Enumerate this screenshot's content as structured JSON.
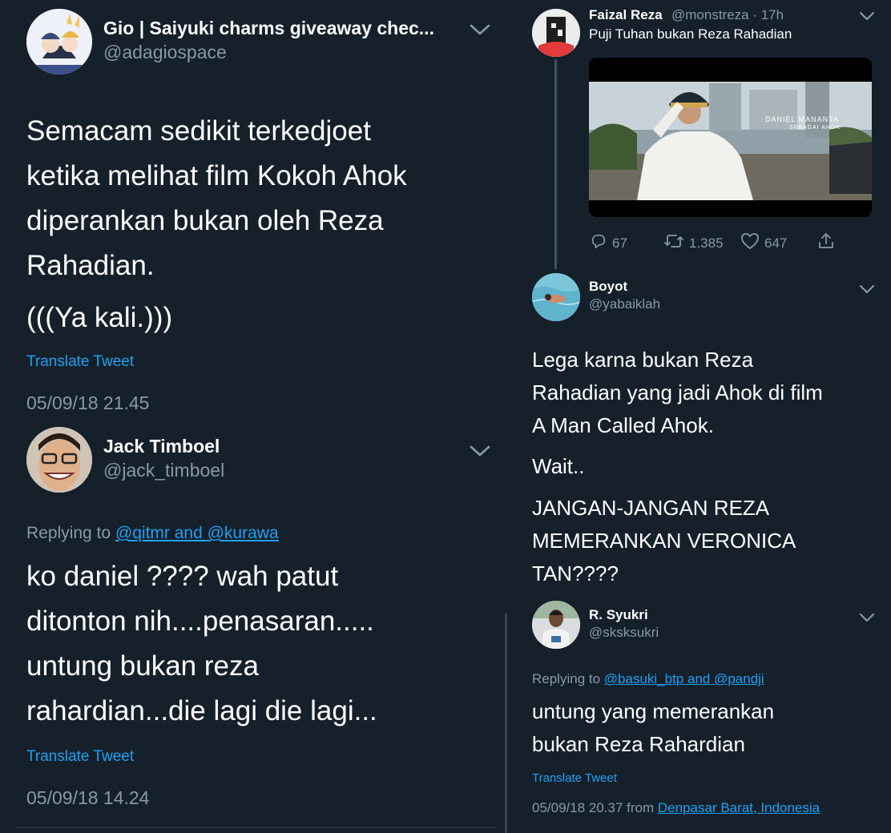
{
  "left": {
    "tweet1": {
      "name": "Gio | Saiyuki charms giveaway chec...",
      "handle": "@adagiospace",
      "text_lines": [
        "Semacam sedikit terkedjoet",
        "ketika melihat film Kokoh Ahok",
        "diperankan bukan oleh Reza",
        "Rahadian."
      ],
      "text2": "(((Ya kali.)))",
      "translate": "Translate Tweet",
      "timestamp": "05/09/18 21.45"
    },
    "tweet2": {
      "name": "Jack Timboel",
      "handle": "@jack_timboel",
      "replying_prefix": "Replying to ",
      "replying_link": "@qitmr and @kurawa",
      "text_lines": [
        "ko daniel ???? wah patut",
        "ditonton nih....penasaran.....",
        "untung bukan reza",
        "rahardian...die lagi die lagi..."
      ],
      "translate": "Translate Tweet",
      "timestamp": "05/09/18 14.24"
    }
  },
  "right": {
    "tweet1": {
      "name": "Faizal Reza",
      "handle_time": "@monstreza · 17h",
      "text": "Puji Tuhan bukan Reza Rahadian",
      "media_caption_1": "DANIEL MANANTA",
      "media_caption_2": "SEBAGAI AHOK",
      "actions": {
        "replies": "67",
        "retweets": "1.385",
        "likes": "647"
      }
    },
    "tweet2": {
      "name": "Boyot",
      "handle": "@yabaiklah",
      "text_lines": [
        "Lega karna bukan Reza",
        "Rahadian yang jadi Ahok di film",
        "A Man Called Ahok."
      ],
      "text2": "Wait..",
      "text3_lines": [
        "JANGAN-JANGAN REZA",
        "MEMERANKAN VERONICA",
        "TAN????"
      ]
    },
    "tweet3": {
      "name": "R. Syukri",
      "handle": "@sksksukri",
      "replying_prefix": "Replying to ",
      "replying_link": "@basuki_btp and @pandji",
      "text_lines": [
        "untung yang memerankan",
        "bukan Reza Rahardian"
      ],
      "translate": "Translate Tweet",
      "timestamp_prefix": "05/09/18 20.37 from ",
      "location": "Denpasar Barat, Indonesia"
    }
  },
  "icons": [
    "chevron-down-icon",
    "reply-icon",
    "retweet-icon",
    "like-icon",
    "share-icon"
  ],
  "colors": {
    "background": "#15202b",
    "accent": "#1da1f2",
    "muted": "#8899a6",
    "text": "#ffffff"
  }
}
